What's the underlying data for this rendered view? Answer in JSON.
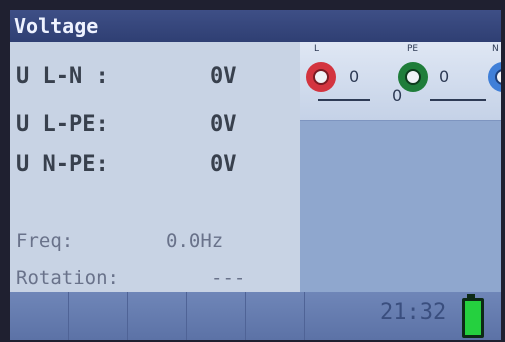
{
  "title": "Voltage",
  "measurements": [
    {
      "label": "U L-N :",
      "value": "0V"
    },
    {
      "label": "U L-PE:",
      "value": "0V"
    },
    {
      "label": "U N-PE:",
      "value": "0V"
    }
  ],
  "frequency": {
    "label": "Freq:",
    "value": "0.0Hz"
  },
  "rotation": {
    "label": "Rotation:",
    "value": "---"
  },
  "terminals": {
    "l": {
      "label": "L",
      "color": "#d3343f"
    },
    "pe": {
      "label": "PE",
      "color": "#1f7d3a"
    },
    "n": {
      "label": "N",
      "color": "#3f7fd8"
    },
    "l_pe_value": "0",
    "pe_n_value": "0",
    "l_n_value": "0"
  },
  "footer": {
    "time": "21:32"
  },
  "battery": {
    "color": "#25d03f"
  }
}
